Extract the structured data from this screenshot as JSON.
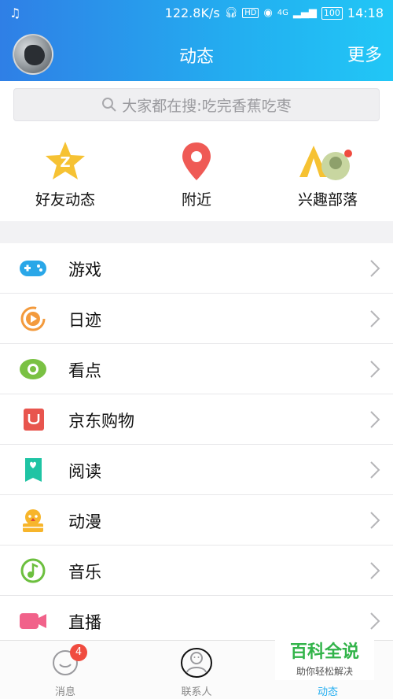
{
  "status_bar": {
    "speed": "122.8K/s",
    "network": "4G",
    "battery": "100",
    "time": "14:18"
  },
  "header": {
    "title": "动态",
    "more": "更多"
  },
  "search": {
    "placeholder": "大家都在搜:吃完香蕉吃枣"
  },
  "shortcuts": [
    {
      "label": "好友动态"
    },
    {
      "label": "附近"
    },
    {
      "label": "兴趣部落"
    }
  ],
  "list": [
    {
      "label": "游戏",
      "icon": "gamepad-icon",
      "color": "#2aa7e8"
    },
    {
      "label": "日迹",
      "icon": "play-circle-icon",
      "color": "#f39a3c"
    },
    {
      "label": "看点",
      "icon": "eye-icon",
      "color": "#7ac143"
    },
    {
      "label": "京东购物",
      "icon": "bag-icon",
      "color": "#e8554e"
    },
    {
      "label": "阅读",
      "icon": "book-icon",
      "color": "#1fc4a4"
    },
    {
      "label": "动漫",
      "icon": "cartoon-icon",
      "color": "#f7b52b"
    },
    {
      "label": "音乐",
      "icon": "music-icon",
      "color": "#6cbf3e"
    },
    {
      "label": "直播",
      "icon": "camera-icon",
      "color": "#f1628a"
    }
  ],
  "bottom_nav": [
    {
      "label": "消息",
      "badge": "4"
    },
    {
      "label": "联系人"
    },
    {
      "label": "动态"
    }
  ],
  "watermark": {
    "main": "百科全说",
    "sub": "助你轻松解决"
  }
}
